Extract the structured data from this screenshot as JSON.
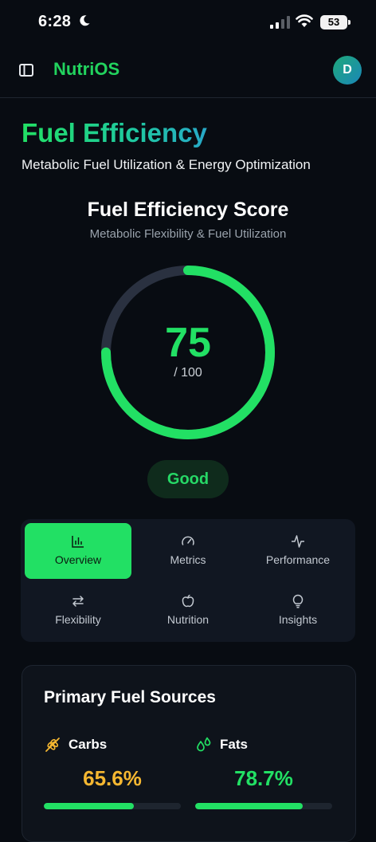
{
  "status_bar": {
    "time": "6:28",
    "battery": "53"
  },
  "header": {
    "brand": "NutriOS",
    "avatar_initial": "D"
  },
  "page": {
    "title": "Fuel Efficiency",
    "subtitle": "Metabolic Fuel Utilization & Energy Optimization"
  },
  "score": {
    "title": "Fuel Efficiency Score",
    "subtitle": "Metabolic Flexibility & Fuel Utilization",
    "value": "75",
    "max_label": "/ 100",
    "fraction": 0.75,
    "rating": "Good",
    "accent": "#22e064",
    "track_color": "#2a3140"
  },
  "tabs": [
    {
      "label": "Overview",
      "icon": "bar-chart-icon",
      "active": true
    },
    {
      "label": "Metrics",
      "icon": "gauge-icon",
      "active": false
    },
    {
      "label": "Performance",
      "icon": "activity-icon",
      "active": false
    },
    {
      "label": "Flexibility",
      "icon": "arrows-swap-icon",
      "active": false
    },
    {
      "label": "Nutrition",
      "icon": "apple-icon",
      "active": false
    },
    {
      "label": "Insights",
      "icon": "lightbulb-icon",
      "active": false
    }
  ],
  "fuel_sources": {
    "title": "Primary Fuel Sources",
    "items": [
      {
        "name": "Carbs",
        "percent": "65.6%",
        "fraction": 0.656,
        "color": "#f5b731",
        "icon": "wheat-icon"
      },
      {
        "name": "Fats",
        "percent": "78.7%",
        "fraction": 0.787,
        "color": "#22e064",
        "icon": "droplets-icon"
      }
    ]
  }
}
